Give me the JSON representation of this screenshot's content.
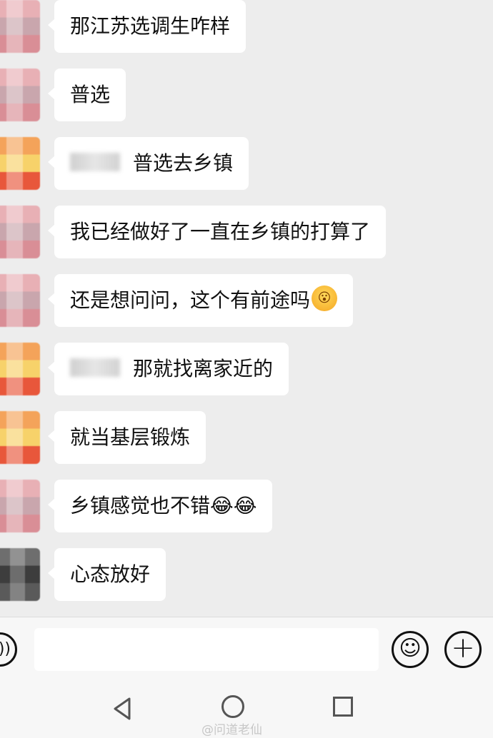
{
  "messages": [
    {
      "text": "那江苏选调生咋样",
      "avatar": "pink",
      "emoji": ""
    },
    {
      "text": "普选",
      "avatar": "pink",
      "emoji": ""
    },
    {
      "text": "普选去乡镇",
      "avatar": "orange",
      "emoji": ""
    },
    {
      "text": "我已经做好了一直在乡镇的打算了",
      "avatar": "pink",
      "emoji": ""
    },
    {
      "text": "还是想问问，这个有前途吗",
      "avatar": "pink",
      "emoji": "😮"
    },
    {
      "text": "那就找离家近的",
      "avatar": "orange",
      "emoji": ""
    },
    {
      "text": "就当基层锻炼",
      "avatar": "orange",
      "emoji": ""
    },
    {
      "text": "乡镇感觉也不错",
      "avatar": "pink",
      "emoji": "😂😂"
    },
    {
      "text": "心态放好",
      "avatar": "dark",
      "emoji": ""
    }
  ],
  "input": {
    "value": "",
    "placeholder": ""
  },
  "icons": {
    "voice": "voice-icon",
    "emoji": "emoji-icon",
    "plus": "plus-icon",
    "back": "nav-back-icon",
    "home": "nav-home-icon",
    "recent": "nav-recent-icon"
  },
  "colors": {
    "background": "#ededed",
    "bubble": "#ffffff",
    "text": "#111111"
  },
  "watermark": "@问道老仙"
}
